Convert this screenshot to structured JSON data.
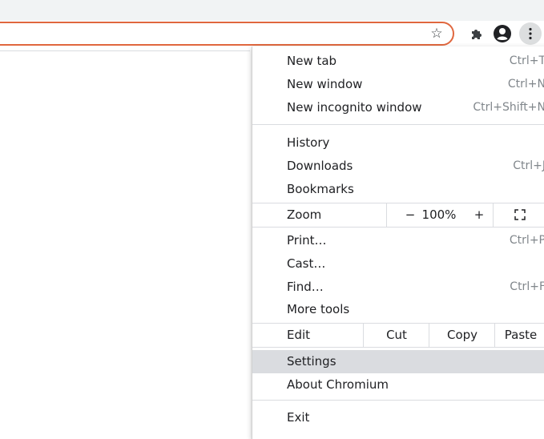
{
  "toolbar": {
    "icons": [
      "star-icon",
      "extensions-icon",
      "profile-icon",
      "menu-dots-icon"
    ]
  },
  "menu": {
    "group1": [
      {
        "label": "New tab",
        "shortcut": "Ctrl+T"
      },
      {
        "label": "New window",
        "shortcut": "Ctrl+N"
      },
      {
        "label": "New incognito window",
        "shortcut": "Ctrl+Shift+N"
      }
    ],
    "group2": [
      {
        "label": "History",
        "shortcut": ""
      },
      {
        "label": "Downloads",
        "shortcut": "Ctrl+J"
      },
      {
        "label": "Bookmarks",
        "shortcut": ""
      }
    ],
    "zoom": {
      "label": "Zoom",
      "minus": "−",
      "value": "100%",
      "plus": "+"
    },
    "group3": [
      {
        "label": "Print…",
        "shortcut": "Ctrl+P"
      },
      {
        "label": "Cast…",
        "shortcut": ""
      },
      {
        "label": "Find…",
        "shortcut": "Ctrl+F"
      },
      {
        "label": "More tools",
        "shortcut": ""
      }
    ],
    "edit": {
      "label": "Edit",
      "cut": "Cut",
      "copy": "Copy",
      "paste": "Paste"
    },
    "settings": "Settings",
    "about": "About Chromium",
    "exit": "Exit"
  },
  "colors": {
    "accent": "#e0673e",
    "highlight": "#dadce0"
  }
}
